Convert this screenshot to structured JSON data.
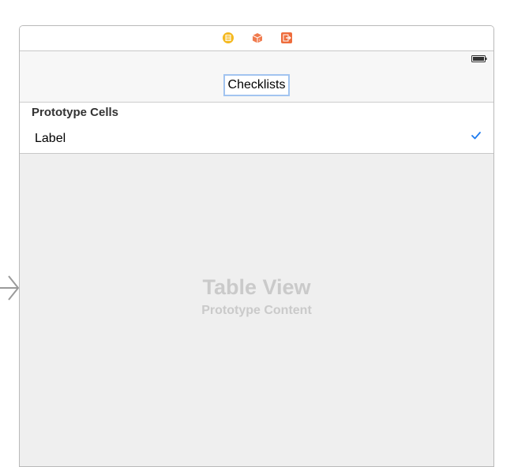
{
  "scene_dock": {
    "icons": [
      "view-controller-icon",
      "first-responder-icon",
      "exit-icon"
    ]
  },
  "nav_bar": {
    "title": "Checklists"
  },
  "table": {
    "section_header": "Prototype Cells",
    "cell_label": "Label",
    "accessory": "checkmark-icon"
  },
  "placeholder": {
    "title": "Table View",
    "subtitle": "Prototype Content"
  },
  "colors": {
    "view_controller_icon": "#F4B81E",
    "first_responder_icon": "#F07B4E",
    "exit_icon": "#EE6C3C",
    "checkmark": "#1E7CF0",
    "placeholder_text": "#CACACA",
    "title_selection_border": "#A2C4F0"
  }
}
